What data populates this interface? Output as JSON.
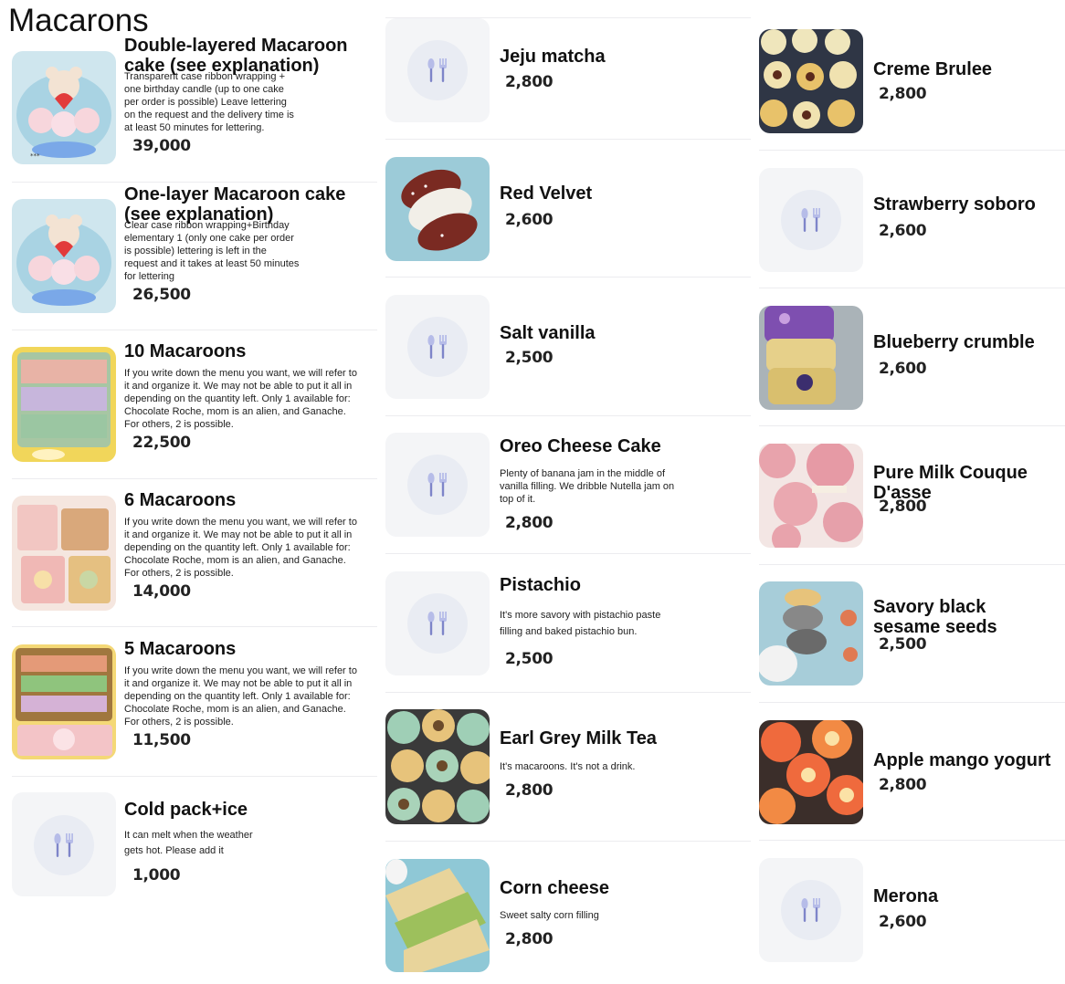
{
  "section": {
    "title": "Macarons"
  },
  "colors": {
    "accent": "#8b8fcf",
    "placeholder_bg": "#f4f5f7",
    "divider": "#ececef"
  },
  "columns": [
    {
      "items": [
        {
          "name": "Double-layered Macaroon cake (see explanation)",
          "desc": "Transparent case ribbon wrapping + one birthday candle (up to one cake per order is possible) Leave lettering on the request and the delivery time is at least 50 minutes for lettering.",
          "price": "39,000",
          "image": "cake-photo"
        },
        {
          "name": "One-layer Macaroon cake (see explanation)",
          "desc": "Clear case ribbon wrapping+Birthday elementary 1 (only one cake per order is possible) lettering is left in the request and it takes at least 50 minutes for lettering",
          "price": "26,500",
          "image": "cake-photo"
        },
        {
          "name": "10 Macaroons",
          "desc": "If you write down the menu you want, we will refer to it and organize it. We may not be able to put it all in depending on the quantity left. Only 1 available for: Chocolate Roche, mom is an alien, and Ganache. For others, 2 is possible.",
          "price": "22,500",
          "image": "box-photo"
        },
        {
          "name": "6 Macaroons",
          "desc": "If you write down the menu you want, we will refer to it and organize it. We may not be able to put it all in depending on the quantity left. Only 1 available for: Chocolate Roche, mom is an alien, and Ganache. For others, 2 is possible.",
          "price": "14,000",
          "image": "gift-photo"
        },
        {
          "name": "5 Macaroons",
          "desc": "If you write down the menu you want, we will refer to it and organize it. We may not be able to put it all in depending on the quantity left. Only 1 available for: Chocolate Roche, mom is an alien, and Ganache. For others, 2 is possible.",
          "price": "11,500",
          "image": "box-photo"
        },
        {
          "name": "Cold pack+ice",
          "desc": "It can melt when the weather gets hot. Please add it",
          "price": "1,000",
          "image": "placeholder"
        }
      ]
    },
    {
      "items": [
        {
          "name": "Jeju matcha",
          "desc": "",
          "price": "2,800",
          "image": "placeholder"
        },
        {
          "name": "Red Velvet",
          "desc": "",
          "price": "2,600",
          "image": "redvelvet-photo"
        },
        {
          "name": "Salt vanilla",
          "desc": "",
          "price": "2,500",
          "image": "placeholder"
        },
        {
          "name": "Oreo Cheese Cake",
          "desc": "Plenty of banana jam in the middle of vanilla filling. We dribble Nutella jam on top of it.",
          "price": "2,800",
          "image": "placeholder"
        },
        {
          "name": "Pistachio",
          "desc": "It's more savory with pistachio paste filling and baked pistachio bun.",
          "price": "2,500",
          "image": "placeholder"
        },
        {
          "name": "Earl Grey Milk Tea",
          "desc": "It's macaroons. It's not a drink.",
          "price": "2,800",
          "image": "earlgrey-photo"
        },
        {
          "name": "Corn cheese",
          "desc": "Sweet salty corn filling",
          "price": "2,800",
          "image": "corn-photo"
        }
      ]
    },
    {
      "items": [
        {
          "name": "Creme Brulee",
          "desc": "",
          "price": "2,800",
          "image": "brulee-photo"
        },
        {
          "name": "Strawberry soboro",
          "desc": "",
          "price": "2,600",
          "image": "placeholder"
        },
        {
          "name": "Blueberry crumble",
          "desc": "",
          "price": "2,600",
          "image": "blueberry-photo"
        },
        {
          "name": "Pure Milk Couque D'asse",
          "desc": "",
          "price": "2,800",
          "image": "pink-photo"
        },
        {
          "name": "Savory black sesame seeds",
          "desc": "",
          "price": "2,500",
          "image": "sesame-photo"
        },
        {
          "name": "Apple mango yogurt",
          "desc": "",
          "price": "2,800",
          "image": "mango-photo"
        },
        {
          "name": "Merona",
          "desc": "",
          "price": "2,600",
          "image": "placeholder"
        }
      ]
    }
  ]
}
